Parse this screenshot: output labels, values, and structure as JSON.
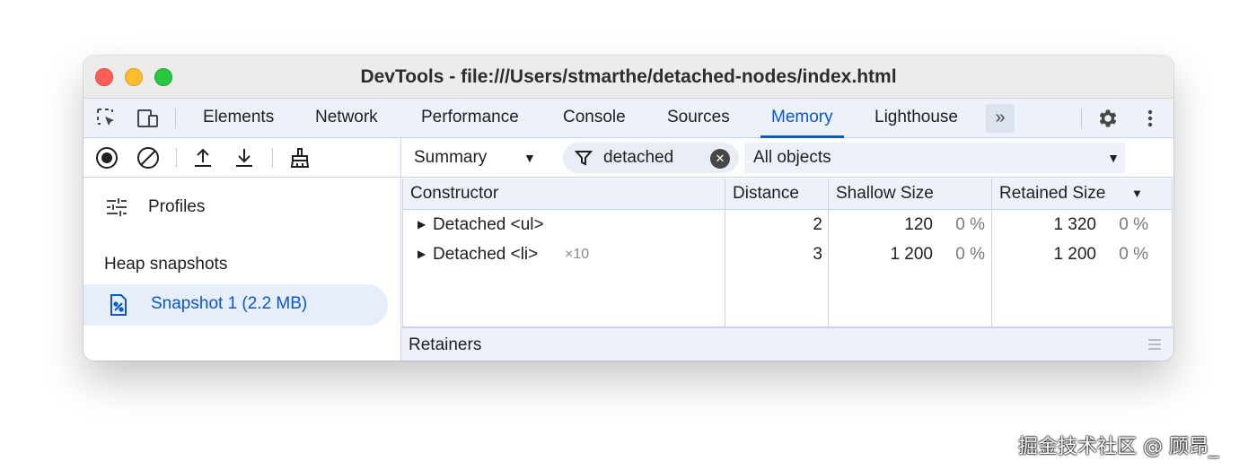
{
  "window": {
    "title": "DevTools - file:///Users/stmarthe/detached-nodes/index.html"
  },
  "tabbar": {
    "left_icons": [
      "inspect-element-icon",
      "device-toolbar-icon"
    ],
    "tabs": [
      {
        "label": "Elements",
        "active": false
      },
      {
        "label": "Network",
        "active": false
      },
      {
        "label": "Performance",
        "active": false
      },
      {
        "label": "Console",
        "active": false
      },
      {
        "label": "Sources",
        "active": false
      },
      {
        "label": "Memory",
        "active": true
      },
      {
        "label": "Lighthouse",
        "active": false
      }
    ],
    "overflow_label": "»",
    "right_icons": [
      "settings-gear-icon",
      "more-options-icon"
    ]
  },
  "memory_toolbar": {
    "icons": [
      "record-icon",
      "clear-icon",
      "load-profile-icon",
      "save-profile-icon",
      "collect-garbage-icon"
    ]
  },
  "sidebar": {
    "profiles_label": "Profiles",
    "section_label": "Heap snapshots",
    "snapshot_label": "Snapshot 1 (2.2 MB)"
  },
  "filters": {
    "view_select": "Summary",
    "class_filter_value": "detached",
    "objects_select": "All objects"
  },
  "table": {
    "headers": {
      "constructor": "Constructor",
      "distance": "Distance",
      "shallow": "Shallow Size",
      "retained": "Retained Size"
    },
    "rows": [
      {
        "name": "Detached <ul>",
        "count": "",
        "distance": "2",
        "shallow": "120",
        "shallow_pct": "0 %",
        "retained": "1 320",
        "retained_pct": "0 %"
      },
      {
        "name": "Detached <li>",
        "count": "×10",
        "distance": "3",
        "shallow": "1 200",
        "shallow_pct": "0 %",
        "retained": "1 200",
        "retained_pct": "0 %"
      }
    ]
  },
  "retainers": {
    "label": "Retainers"
  },
  "watermark": "掘金技术社区 @ 顾昂_",
  "colors": {
    "accent": "#0b57d0",
    "toolbar_bg": "#edf2fa",
    "selected_bg": "#e6edfb",
    "border": "#c7d3ec"
  }
}
